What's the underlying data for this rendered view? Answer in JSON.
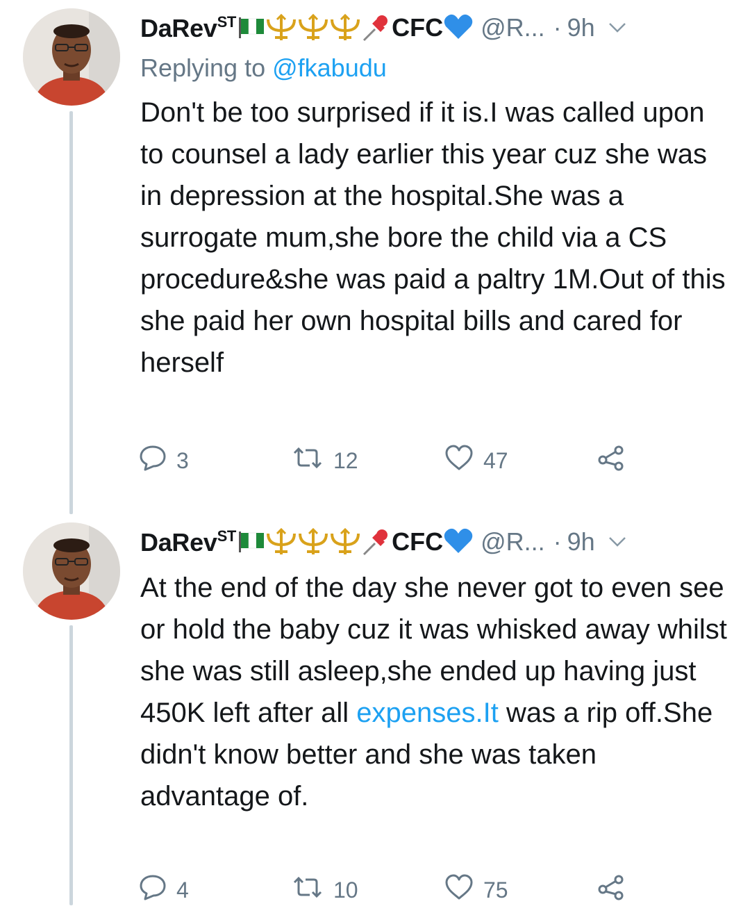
{
  "tweets": [
    {
      "author": {
        "name": "DaRev",
        "name_sup": "ST",
        "suffix": "CFC",
        "handle": "@R...",
        "dot": "·",
        "time": "9h"
      },
      "replying_prefix": "Replying to ",
      "replying_to": "@fkabudu",
      "text": "Don't be too surprised if it is.I was called upon to counsel a lady earlier this year cuz she was in depression at the hospital.She was a surrogate mum,she bore the child via a CS procedure&she was paid a paltry 1M.Out of this she paid her own hospital bills and cared for herself",
      "replies": "3",
      "retweets": "12",
      "likes": "47"
    },
    {
      "author": {
        "name": "DaRev",
        "name_sup": "ST",
        "suffix": "CFC",
        "handle": "@R...",
        "dot": "·",
        "time": "9h"
      },
      "text_before_link": "At the end of the day she never got to even see or hold the baby cuz it was whisked away whilst she was still asleep,she ended up having just 450K left after all ",
      "link_text": "expenses.It",
      "text_after_link": " was a rip off.She didn't know better and she was taken advantage of.",
      "replies": "4",
      "retweets": "10",
      "likes": "75"
    }
  ],
  "icons": {
    "flag": "nigeria-flag-icon",
    "trident": "trident-icon",
    "pin": "pushpin-icon",
    "heart": "blue-heart-icon",
    "caret": "chevron-down-icon",
    "reply": "reply-icon",
    "retweet": "retweet-icon",
    "like": "heart-icon",
    "share": "share-icon"
  },
  "colors": {
    "text": "#14171a",
    "secondary": "#657786",
    "link": "#1da1f2",
    "thread": "#ccd6dd",
    "heart_blue": "#2f8fe8",
    "trident_gold": "#d9a21b",
    "pin_red": "#e0323c",
    "flag_green": "#1e8a3a"
  }
}
